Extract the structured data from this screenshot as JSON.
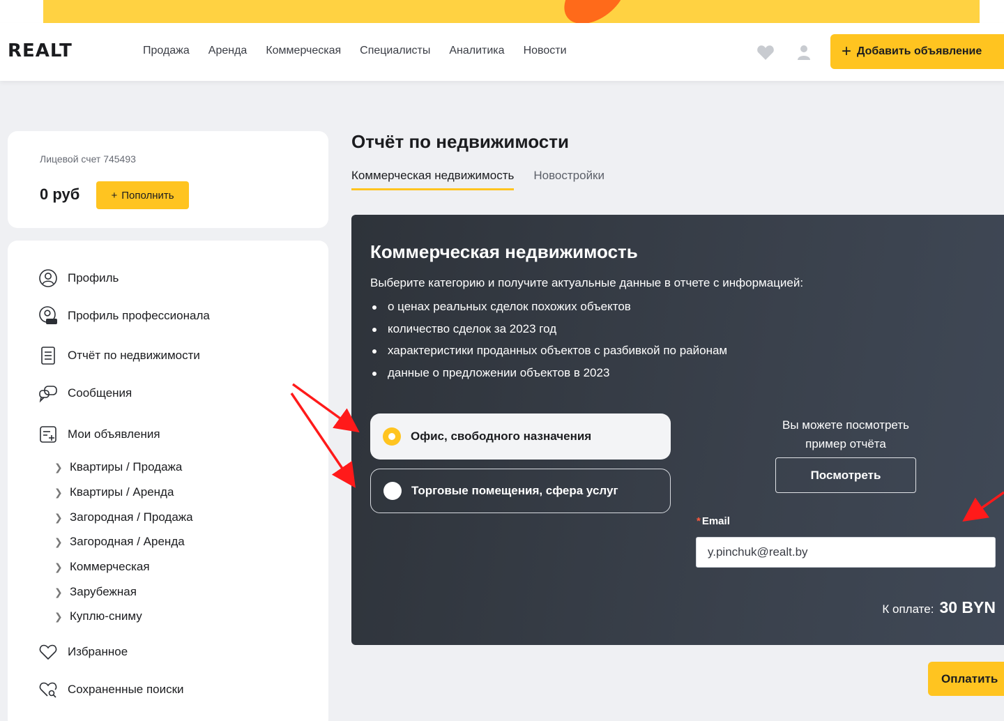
{
  "brand": {
    "logo": "REALT",
    "accent": "#ffc420",
    "dark_panel": "#343a43",
    "annotation": "#ff1a1a"
  },
  "header": {
    "nav": [
      "Продажа",
      "Аренда",
      "Коммерческая",
      "Специалисты",
      "Аналитика",
      "Новости"
    ],
    "favorites_icon": "heart-icon",
    "user_icon": "user-icon",
    "add_button": "Добавить объявление"
  },
  "account": {
    "label": "Лицевой счет 745493",
    "balance": "0 руб",
    "topup_button": "Пополнить"
  },
  "sidebar": {
    "items": [
      {
        "label": "Профиль",
        "icon": "user-circle-icon"
      },
      {
        "label": "Профиль профессионала",
        "icon": "pro-profile-icon"
      },
      {
        "label": "Отчёт по недвижимости",
        "icon": "document-icon"
      },
      {
        "label": "Сообщения",
        "icon": "chat-icon"
      },
      {
        "label": "Мои объявления",
        "icon": "listing-icon"
      }
    ],
    "sub_items": [
      "Квартиры / Продажа",
      "Квартиры / Аренда",
      "Загородная / Продажа",
      "Загородная / Аренда",
      "Коммерческая",
      "Зарубежная",
      "Куплю-сниму"
    ],
    "bottom_items": [
      {
        "label": "Избранное",
        "icon": "heart-outline-icon"
      },
      {
        "label": "Сохраненные поиски",
        "icon": "saved-search-icon"
      }
    ]
  },
  "main": {
    "title": "Отчёт по недвижимости",
    "tabs": [
      {
        "label": "Коммерческая недвижимость",
        "active": true
      },
      {
        "label": "Новостройки",
        "active": false
      }
    ],
    "panel": {
      "title": "Коммерческая недвижимость",
      "intro": "Выберите категорию и получите актуальные данные в отчете с информацией:",
      "bullets": [
        "о ценах реальных сделок похожих объектов",
        "количество сделок за 2023 год",
        "характеристики проданных объектов с разбивкой по районам",
        "данные о предложении объектов в 2023"
      ],
      "options": [
        {
          "label": "Офис, свободного назначения",
          "selected": true
        },
        {
          "label": "Торговые помещения, сфера услуг",
          "selected": false
        }
      ],
      "example_text_1": "Вы можете посмотреть",
      "example_text_2": "пример отчёта",
      "view_button": "Посмотреть",
      "email_label": "Email",
      "email_value": "y.pinchuk@realt.by",
      "pay_label": "К оплате:",
      "pay_amount": "30 BYN"
    },
    "pay_button": "Оплатить"
  }
}
